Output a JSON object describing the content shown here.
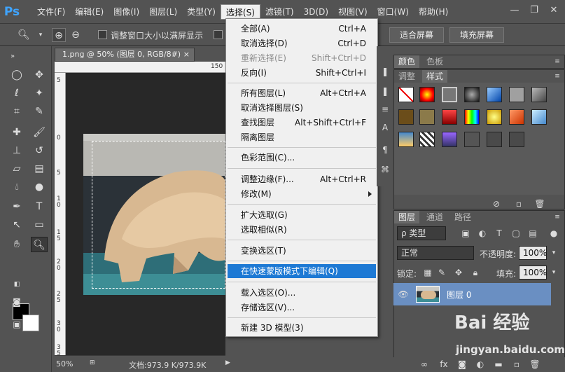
{
  "app": {
    "logo": "Ps"
  },
  "menubar": {
    "items": [
      "文件(F)",
      "编辑(E)",
      "图像(I)",
      "图层(L)",
      "类型(Y)",
      "选择(S)",
      "滤镜(T)",
      "3D(D)",
      "视图(V)",
      "窗口(W)",
      "帮助(H)"
    ],
    "active_index": 5
  },
  "window_controls": {
    "minimize": "—",
    "restore": "❐",
    "close": "✕"
  },
  "options_bar": {
    "resize_windows_label": "调整窗口大小以满屏显示",
    "fit_screen_button": "适合屏幕",
    "fill_screen_button": "填充屏幕"
  },
  "document": {
    "tab_title": "1.png @ 50% (图层 0, RGB/8#)",
    "tab_close": "×",
    "ruler_h_labels": [
      "150"
    ],
    "ruler_v_labels": [
      "5",
      "0",
      "5",
      "1 0",
      "1 5",
      "2 0",
      "2 5",
      "3 0",
      "3 5",
      "4"
    ],
    "zoom": "50%",
    "doc_info": "文档:973.9 K/973.9K"
  },
  "select_menu": {
    "items": [
      {
        "label": "全部(A)",
        "shortcut": "Ctrl+A"
      },
      {
        "label": "取消选择(D)",
        "shortcut": "Ctrl+D"
      },
      {
        "label": "重新选择(E)",
        "shortcut": "Shift+Ctrl+D",
        "disabled": true
      },
      {
        "label": "反向(I)",
        "shortcut": "Shift+Ctrl+I"
      },
      {
        "label": "所有图层(L)",
        "shortcut": "Alt+Ctrl+A"
      },
      {
        "label": "取消选择图层(S)",
        "shortcut": ""
      },
      {
        "label": "查找图层",
        "shortcut": "Alt+Shift+Ctrl+F"
      },
      {
        "label": "隔离图层",
        "shortcut": ""
      },
      {
        "label": "色彩范围(C)...",
        "shortcut": ""
      },
      {
        "label": "调整边缘(F)...",
        "shortcut": "Alt+Ctrl+R"
      },
      {
        "label": "修改(M)",
        "shortcut": "",
        "submenu": true
      },
      {
        "label": "扩大选取(G)",
        "shortcut": ""
      },
      {
        "label": "选取相似(R)",
        "shortcut": ""
      },
      {
        "label": "变换选区(T)",
        "shortcut": ""
      },
      {
        "label": "在快速蒙版模式下编辑(Q)",
        "shortcut": "",
        "highlighted": true
      },
      {
        "label": "载入选区(O)...",
        "shortcut": ""
      },
      {
        "label": "存储选区(V)...",
        "shortcut": ""
      },
      {
        "label": "新建 3D 模型(3)",
        "shortcut": ""
      }
    ]
  },
  "color_panel": {
    "tabs": [
      "颜色",
      "色板"
    ]
  },
  "styles_panel": {
    "tabs": [
      "调整",
      "样式"
    ]
  },
  "layers_panel": {
    "tabs": [
      "图层",
      "通道",
      "路径"
    ],
    "filter_label": "ρ 类型",
    "blend_mode": "正常",
    "opacity_label": "不透明度:",
    "opacity_value": "100%",
    "lock_label": "锁定:",
    "fill_label": "填充:",
    "fill_value": "100%",
    "layers": [
      {
        "name": "图层 0"
      }
    ]
  },
  "watermark": {
    "brand": "Bai 经验",
    "url": "jingyan.baidu.com"
  },
  "colors": {
    "accent": "#1d79d4",
    "layer_selected": "#6a8fc2",
    "ps_blue": "#3fa4ff"
  }
}
